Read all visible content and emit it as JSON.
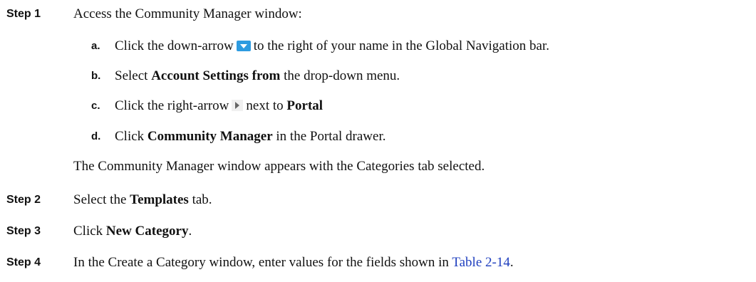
{
  "steps": [
    {
      "label": "Step 1",
      "text": "Access the Community Manager window:",
      "substeps": [
        {
          "label": "a.",
          "part1": "Click the down-arrow",
          "icon": "down-arrow-icon",
          "part2": "to the right of your name in the Global Navigation bar."
        },
        {
          "label": "b.",
          "part1": "Select",
          "bold": "Account Settings from",
          "part2": "the drop-down menu."
        },
        {
          "label": "c.",
          "part1": "Click the right-arrow",
          "icon": "right-arrow-icon",
          "part2": "next to",
          "bold": "Portal"
        },
        {
          "label": "d.",
          "part1": "Click",
          "bold": "Community Manager",
          "part2": "in the Portal drawer."
        }
      ],
      "result": "The Community Manager window appears with the Categories tab selected."
    },
    {
      "label": "Step 2",
      "part1": "Select the",
      "bold": "Templates",
      "part2": "tab."
    },
    {
      "label": "Step 3",
      "part1": "Click",
      "bold": "New Category",
      "part2": "."
    },
    {
      "label": "Step 4",
      "part1": "In the Create a Category window, enter values for the fields shown in",
      "link": "Table 2-14",
      "part2": "."
    }
  ],
  "colors": {
    "link": "#1f3fbf",
    "down_arrow_icon": "#2e9be0"
  }
}
